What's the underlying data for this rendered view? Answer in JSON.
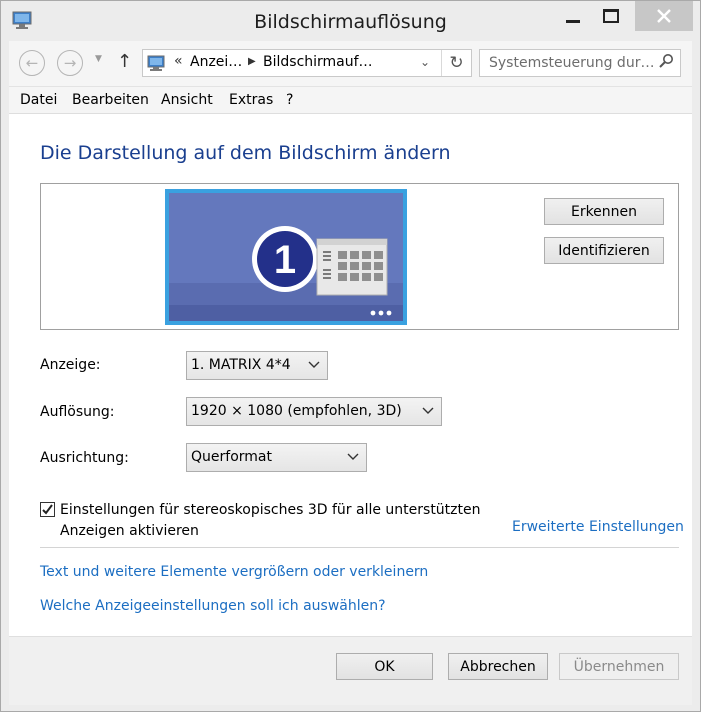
{
  "window": {
    "title": "Bildschirmauflösung",
    "icons": {
      "app": "display-icon",
      "minimize": "minimize-icon",
      "maximize": "maximize-icon",
      "close": "close-icon"
    }
  },
  "nav": {
    "breadcrumb": [
      "Anzei…",
      "Bildschirmauf…"
    ],
    "overflow": "«",
    "search_placeholder": "Systemsteuerung dur…"
  },
  "menu": [
    "Datei",
    "Bearbeiten",
    "Ansicht",
    "Extras",
    "?"
  ],
  "main": {
    "heading": "Die Darstellung auf dem Bildschirm ändern",
    "monitor_number": "1",
    "detect_button": "Erkennen",
    "identify_button": "Identifizieren",
    "display": {
      "label": "Anzeige:",
      "value": "1. MATRIX 4*4"
    },
    "resolution": {
      "label": "Auflösung:",
      "value": "1920 × 1080 (empfohlen, 3D)"
    },
    "orientation": {
      "label": "Ausrichtung:",
      "value": "Querformat"
    },
    "stereo_checkbox": {
      "checked": true,
      "label": "Einstellungen für stereoskopisches 3D für alle unterstützten Anzeigen aktivieren"
    },
    "advanced_link": "Erweiterte Einstellungen",
    "link_text_size": "Text und weitere Elemente vergrößern oder verkleinern",
    "link_which_settings": "Welche Anzeigeeinstellungen soll ich auswählen?"
  },
  "footer": {
    "ok": "OK",
    "cancel": "Abbrechen",
    "apply": "Übernehmen"
  },
  "colors": {
    "heading": "#1a3f8f",
    "link": "#1c6ec2",
    "monitor_screen": "#5a6cb0",
    "monitor_border": "#3aa1e0"
  }
}
